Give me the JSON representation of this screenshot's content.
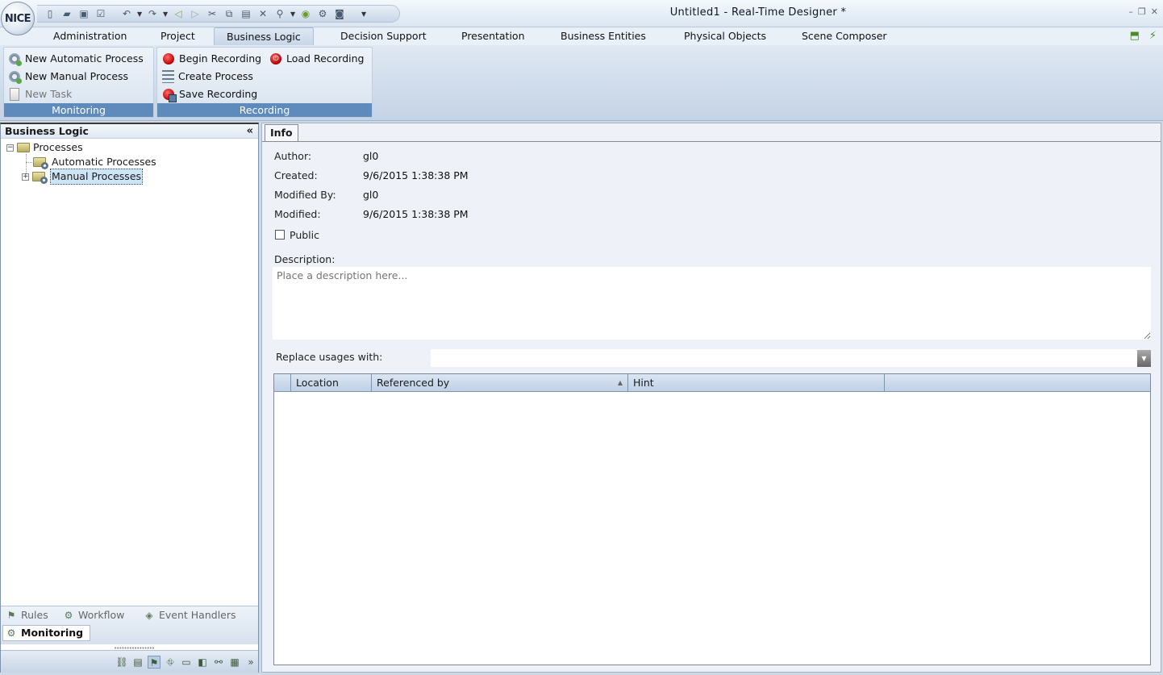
{
  "window": {
    "title": "Untitled1 - Real-Time Designer *",
    "logo_text": "NICE"
  },
  "menu": {
    "tabs": [
      "Administration",
      "Project",
      "Business Logic",
      "Decision Support",
      "Presentation",
      "Business Entities",
      "Physical Objects",
      "Scene Composer"
    ],
    "active": "Business Logic"
  },
  "ribbon": {
    "monitoring": {
      "label": "Monitoring",
      "new_automatic_process": "New Automatic Process",
      "new_manual_process": "New Manual Process",
      "new_task": "New Task"
    },
    "recording": {
      "label": "Recording",
      "begin_recording": "Begin Recording",
      "load_recording": "Load Recording",
      "create_process": "Create Process",
      "save_recording": "Save Recording"
    }
  },
  "left_panel": {
    "title": "Business Logic",
    "collapse_glyph": "«",
    "tree": {
      "root": "Processes",
      "children": [
        "Automatic Processes",
        "Manual Processes"
      ],
      "selected": "Manual Processes"
    },
    "tabs": {
      "rules": "Rules",
      "workflow": "Workflow",
      "event_handlers": "Event Handlers",
      "monitoring": "Monitoring"
    }
  },
  "info": {
    "tab_label": "Info",
    "author_label": "Author:",
    "author": "gl0",
    "created_label": "Created:",
    "created": "9/6/2015 1:38:38 PM",
    "modified_by_label": "Modified By:",
    "modified_by": "gl0",
    "modified_label": "Modified:",
    "modified": "9/6/2015 1:38:38 PM",
    "public_label": "Public",
    "public_checked": false,
    "description_label": "Description:",
    "description_placeholder": "Place a description here...",
    "replace_label": "Replace usages with:",
    "replace_value": ""
  },
  "usages_table": {
    "columns": [
      "Location",
      "Referenced by",
      "Hint"
    ],
    "sorted_by": "Referenced by",
    "rows": []
  }
}
